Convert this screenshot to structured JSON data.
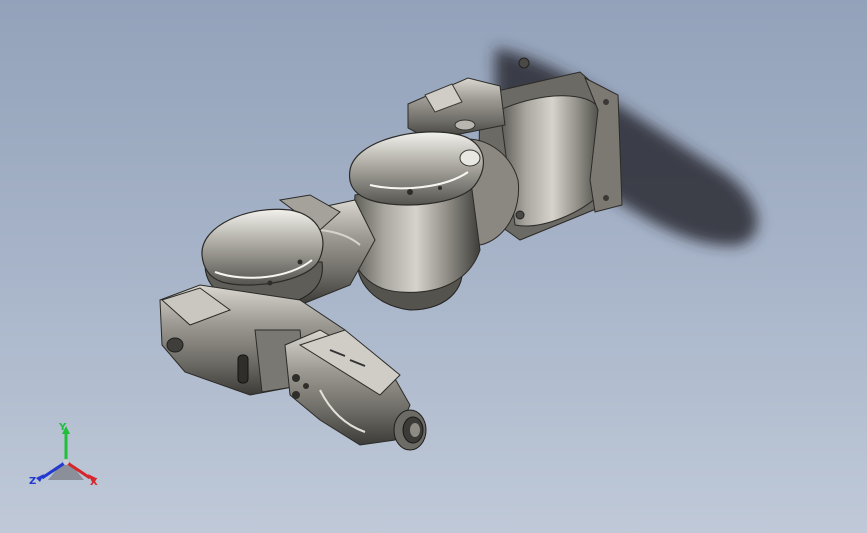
{
  "viewport": {
    "background_top": "#93a2ba",
    "background_bottom": "#bfc9d8",
    "model": {
      "body_color": "#8f8d85",
      "highlight_color": "#ecebe5",
      "shadow_color": "#2e2d29"
    }
  },
  "triad": {
    "x_label": "X",
    "y_label": "Y",
    "z_label": "Z",
    "x_color": "#d6262b",
    "y_color": "#1fbf3a",
    "z_color": "#2238d0"
  }
}
